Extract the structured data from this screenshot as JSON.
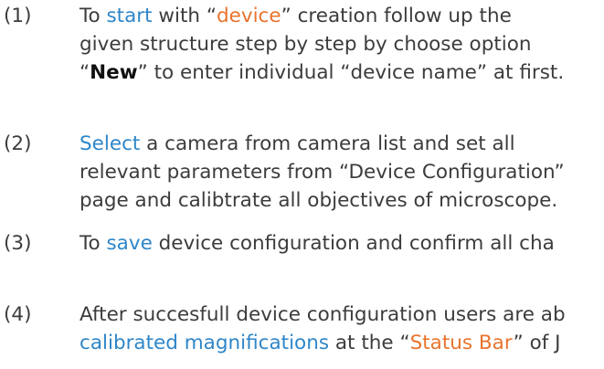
{
  "steps": [
    {
      "number": "(1)",
      "lines": [
        {
          "a": "To ",
          "b": "start",
          "c": " with “",
          "d": "device",
          "e": "” creation follow up the"
        },
        {
          "a": "given structure step by step by choose option"
        },
        {
          "a": "“",
          "b": "New",
          "c": "” to enter individual “device name” at first."
        }
      ]
    },
    {
      "number": "(2)",
      "lines": [
        {
          "a": "Select",
          "b": " a camera from camera list and set all"
        },
        {
          "a": "relevant parameters from “Device Configuration”"
        },
        {
          "a": "page and calibtrate all objectives of microscope."
        }
      ]
    },
    {
      "number": "(3)",
      "lines": [
        {
          "a": "To ",
          "b": "save",
          "c": " device configuration and confirm all cha"
        }
      ]
    },
    {
      "number": "(4)",
      "lines": [
        {
          "a": "After succesfull device configuration users are ab"
        },
        {
          "a": "calibrated magnifications",
          "b": " at the “",
          "c": "Status Bar",
          "d": "” of J"
        }
      ]
    }
  ],
  "colors": {
    "text": "#3c3c3c",
    "link_blue": "#2f86c8",
    "highlight_orange": "#e8742c",
    "bold": "#111111"
  }
}
